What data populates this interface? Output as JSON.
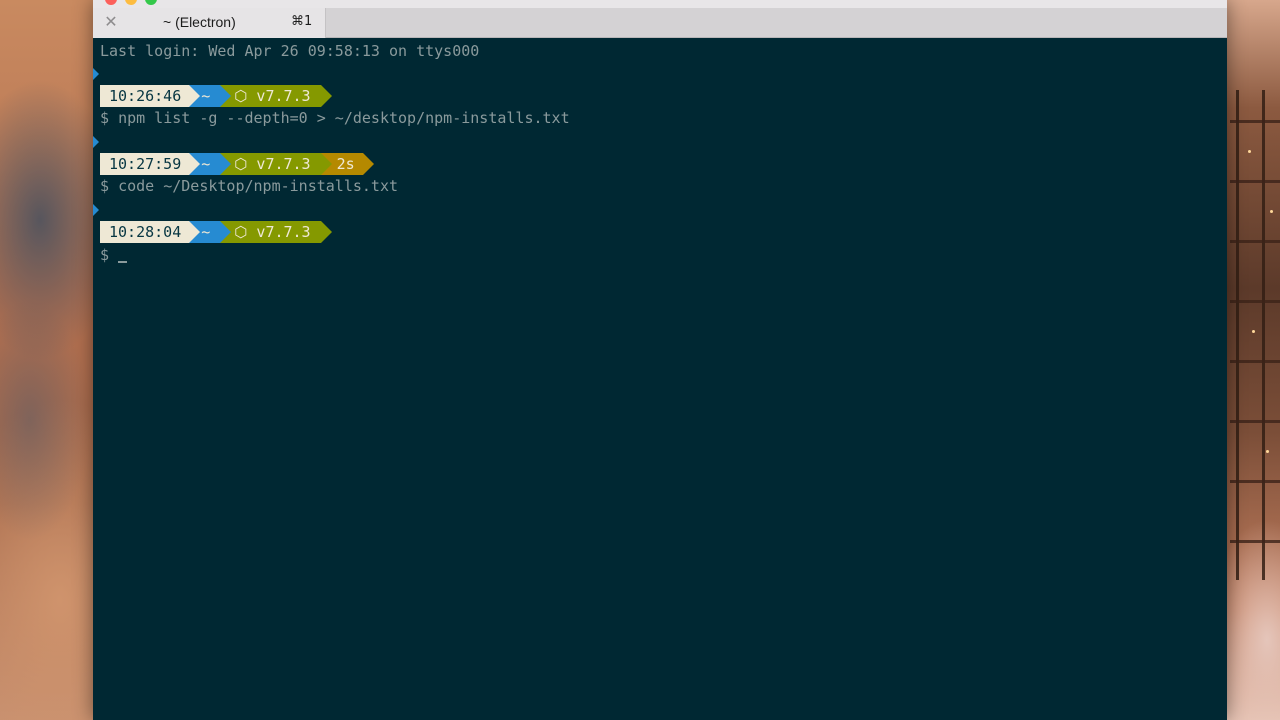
{
  "tab": {
    "title": "~ (Electron)",
    "shortcut": "⌘1"
  },
  "terminal": {
    "last_login": "Last login: Wed Apr 26 09:58:13 on ttys000",
    "prompt_symbol": "$",
    "blocks": [
      {
        "time": "10:26:46",
        "dir": "~",
        "node": "⬡ v7.7.3",
        "command": "npm list -g --depth=0 > ~/desktop/npm-installs.txt"
      },
      {
        "time": "10:27:59",
        "dir": "~",
        "node": "⬡ v7.7.3",
        "duration": "2s",
        "command": "code ~/Desktop/npm-installs.txt"
      },
      {
        "time": "10:28:04",
        "dir": "~",
        "node": "⬡ v7.7.3",
        "command": ""
      }
    ]
  },
  "colors": {
    "terminal_bg": "#002833",
    "time_segment": "#eee8d5",
    "dir_segment": "#268bd2",
    "node_segment": "#859900",
    "duration_segment": "#b58900"
  }
}
